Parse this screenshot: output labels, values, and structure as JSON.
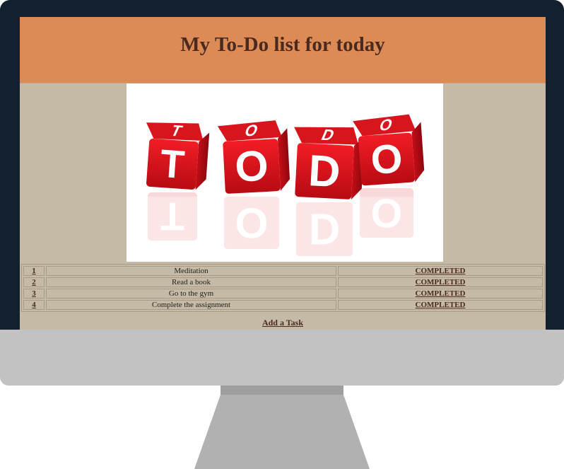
{
  "page": {
    "title": "My To-Do list for today"
  },
  "banner": {
    "image_name": "todo-cubes-image",
    "letters": [
      "T",
      "O",
      "D",
      "O"
    ],
    "cube_color": "#e2101b"
  },
  "tasks": [
    {
      "number": "1",
      "task": "Meditation",
      "status": "COMPLETED"
    },
    {
      "number": "2",
      "task": "Read a book",
      "status": "COMPLETED"
    },
    {
      "number": "3",
      "task": "Go to the gym",
      "status": "COMPLETED"
    },
    {
      "number": "4",
      "task": "Complete the assignment",
      "status": "COMPLETED"
    }
  ],
  "actions": {
    "add_task_label": "Add a Task"
  },
  "colors": {
    "header_bg": "#dd8b55",
    "page_bg": "#c5baa5",
    "title_color": "#4a2a1f",
    "bezel": "#13202f",
    "stand": "#c2c2c2"
  }
}
